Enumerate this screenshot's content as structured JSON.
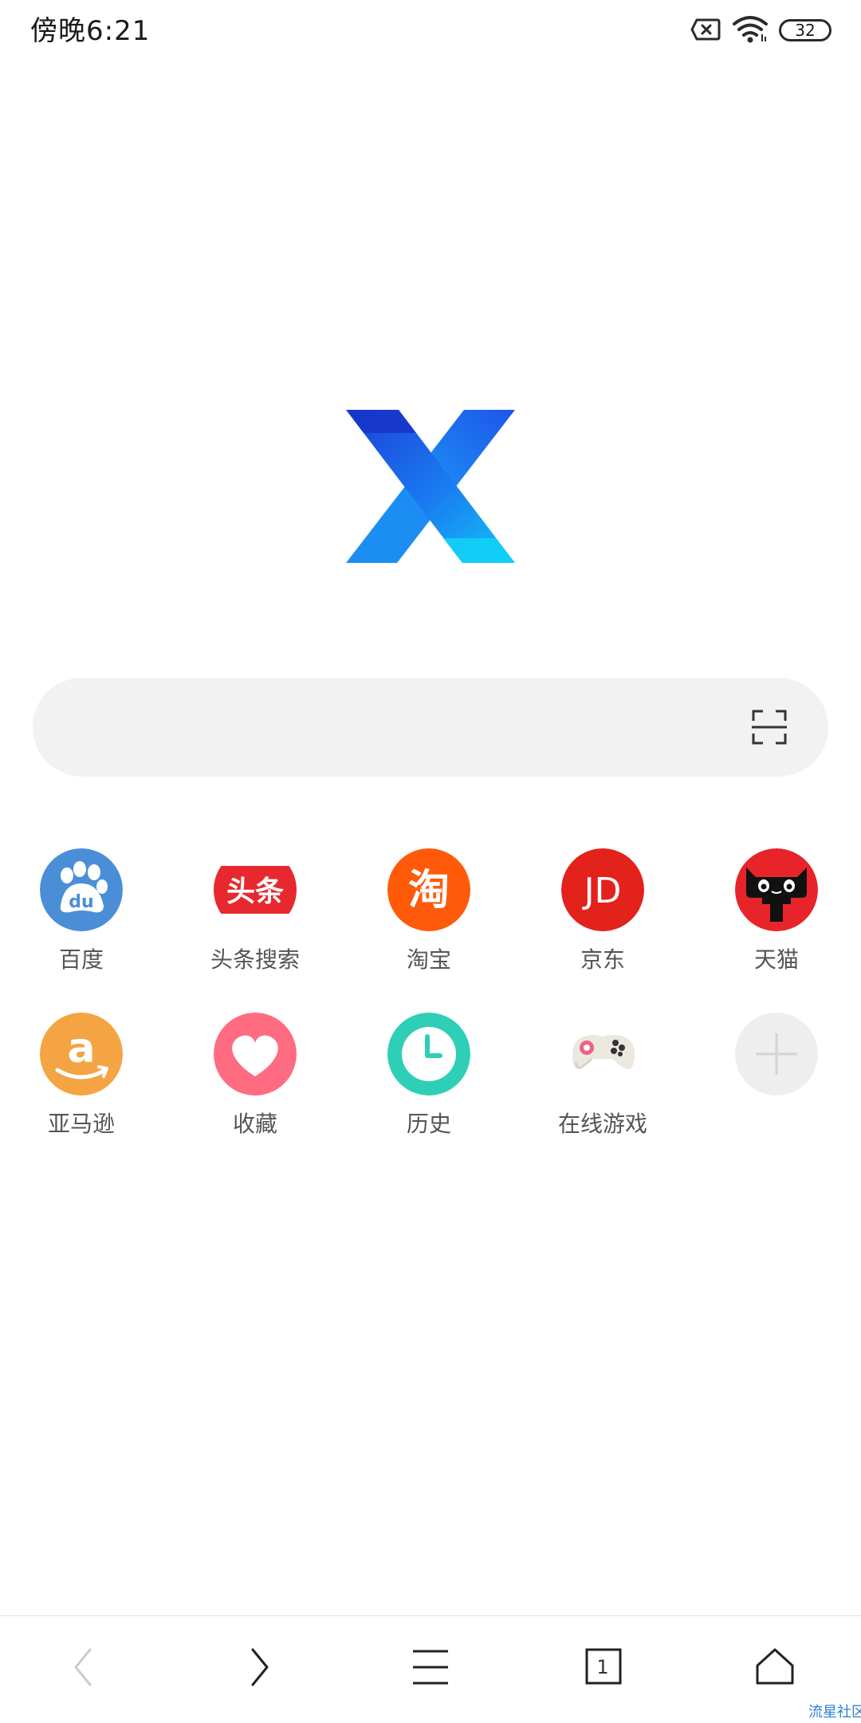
{
  "status_bar": {
    "time": "傍晚6:21",
    "battery_level": "32",
    "icons": [
      "sim-x-icon",
      "wifi-icon",
      "battery-icon"
    ]
  },
  "logo": {
    "name": "x-logo-icon"
  },
  "search": {
    "placeholder": "",
    "scan_icon": "scan-icon"
  },
  "shortcuts": [
    {
      "label": "百度",
      "icon": "baidu-icon",
      "color": "#4a8ed8"
    },
    {
      "label": "头条搜索",
      "icon": "toutiao-icon",
      "color": "#e7292f"
    },
    {
      "label": "淘宝",
      "icon": "taobao-icon",
      "color": "#ff5a0a"
    },
    {
      "label": "京东",
      "icon": "jd-icon",
      "color": "#e3221b"
    },
    {
      "label": "天猫",
      "icon": "tmall-icon",
      "color": "#e8242b"
    },
    {
      "label": "亚马逊",
      "icon": "amazon-icon",
      "color": "#f4a442"
    },
    {
      "label": "收藏",
      "icon": "favorites-heart-icon",
      "color": "#ff6b80"
    },
    {
      "label": "历史",
      "icon": "history-clock-icon",
      "color": "#2ecfb6"
    },
    {
      "label": "在线游戏",
      "icon": "gamepad-icon",
      "color": "#ebe8e0"
    },
    {
      "label": "",
      "icon": "add-icon",
      "color": "#eeeeee"
    }
  ],
  "toutiao_text": "头条",
  "taobao_text": "淘",
  "jd_text": "JD",
  "amazon_text": "a",
  "baidu_text": "du",
  "bottom_nav": {
    "tab_count": "1",
    "items": [
      "back-icon",
      "forward-icon",
      "menu-icon",
      "tabs-icon",
      "home-icon"
    ]
  },
  "watermark": "流星社区"
}
